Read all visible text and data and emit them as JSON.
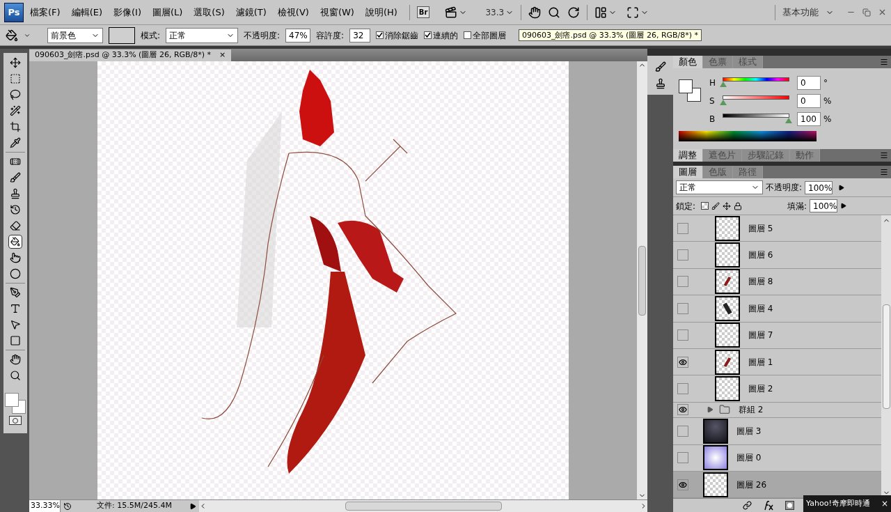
{
  "app_logo": "Ps",
  "menu": [
    "檔案(F)",
    "編輯(E)",
    "影像(I)",
    "圖層(L)",
    "選取(S)",
    "濾鏡(T)",
    "檢視(V)",
    "視窗(W)",
    "說明(H)"
  ],
  "app_bar": {
    "bridge": "Br",
    "zoom": "33.3",
    "workspace": "基本功能"
  },
  "options": {
    "fill_source": "前景色",
    "mode_label": "模式:",
    "mode": "正常",
    "opacity_label": "不透明度:",
    "opacity": "47%",
    "tolerance_label": "容許度:",
    "tolerance": "32",
    "checkboxes": [
      {
        "label": "消除鋸齒",
        "checked": true
      },
      {
        "label": "連續的",
        "checked": true
      },
      {
        "label": "全部圖層",
        "checked": false
      }
    ]
  },
  "tooltip": "090603_劍痞.psd @ 33.3% (圖層 26, RGB/8*) *",
  "document": {
    "tab_title": "090603_劍痞.psd @ 33.3% (圖層 26, RGB/8*) *",
    "close": "×"
  },
  "tools": [
    {
      "kind": "move",
      "selected": false
    },
    {
      "kind": "marquee",
      "selected": false
    },
    {
      "kind": "lasso",
      "selected": false
    },
    {
      "kind": "wand",
      "selected": false
    },
    {
      "kind": "crop",
      "selected": false
    },
    {
      "kind": "eyedropper",
      "selected": false
    },
    {
      "kind": "healing",
      "selected": false
    },
    {
      "kind": "brush",
      "selected": false
    },
    {
      "kind": "stamp",
      "selected": false
    },
    {
      "kind": "history",
      "selected": false
    },
    {
      "kind": "eraser",
      "selected": false
    },
    {
      "kind": "bucket",
      "selected": true
    },
    {
      "kind": "smudge",
      "selected": false
    },
    {
      "kind": "dodge",
      "selected": false
    },
    {
      "kind": "pen",
      "selected": false
    },
    {
      "kind": "type",
      "selected": false
    },
    {
      "kind": "select",
      "selected": false
    },
    {
      "kind": "shape",
      "selected": false
    },
    {
      "kind": "hand",
      "selected": false
    },
    {
      "kind": "zoom",
      "selected": false
    }
  ],
  "status_bar": {
    "zoom": "33.33%",
    "doc_info": "文件: 15.5M/245.4M"
  },
  "color_panel": {
    "tabs": [
      {
        "label": "顏色",
        "selected": true
      },
      {
        "label": "色票",
        "selected": false
      },
      {
        "label": "樣式",
        "selected": false
      }
    ],
    "sliders": [
      {
        "kind": "hue",
        "label": "H",
        "value": "0",
        "unit": "°",
        "level": 0
      },
      {
        "kind": "saturation",
        "label": "S",
        "value": "0",
        "unit": "%",
        "level": 0
      },
      {
        "kind": "brightness",
        "label": "B",
        "value": "100",
        "unit": "%",
        "level": 1
      }
    ]
  },
  "adjust_tabs": [
    {
      "label": "調整",
      "selected": true
    },
    {
      "label": "遮色片",
      "selected": false
    },
    {
      "label": "步驟記錄",
      "selected": false
    },
    {
      "label": "動作",
      "selected": false
    }
  ],
  "layers_panel": {
    "tabs": [
      {
        "label": "圖層",
        "selected": true
      },
      {
        "label": "色版",
        "selected": false
      },
      {
        "label": "路徑",
        "selected": false
      }
    ],
    "blend_mode": "正常",
    "opacity_label": "不透明度:",
    "opacity": "100%",
    "lock_label": "鎖定:",
    "fill_label": "填滿:",
    "fill": "100%",
    "layers": [
      {
        "kind": "group_layer",
        "name": "圖層 5",
        "visible": false,
        "selected": false
      },
      {
        "kind": "group_layer",
        "name": "圖層 6",
        "visible": false,
        "selected": false
      },
      {
        "kind": "group_layer",
        "name": "圖層 8",
        "visible": false,
        "selected": false
      },
      {
        "kind": "group_layer",
        "name": "圖層 4",
        "visible": false,
        "selected": false
      },
      {
        "kind": "group_layer",
        "name": "圖層 7",
        "visible": false,
        "selected": false
      },
      {
        "kind": "group_layer",
        "name": "圖層 1",
        "visible": true,
        "selected": false
      },
      {
        "kind": "group_layer",
        "name": "圖層 2",
        "visible": false,
        "selected": false
      },
      {
        "kind": "group",
        "name": "群組 2",
        "visible": true,
        "selected": false
      },
      {
        "kind": "layer",
        "name": "圖層 3",
        "visible": false,
        "selected": false
      },
      {
        "kind": "layer",
        "name": "圖層 0",
        "visible": false,
        "selected": false
      },
      {
        "kind": "layer",
        "name": "圖層 26",
        "visible": true,
        "selected": true
      }
    ]
  },
  "notification": {
    "title": "Yahoo!奇摩即時通",
    "close": "×"
  }
}
